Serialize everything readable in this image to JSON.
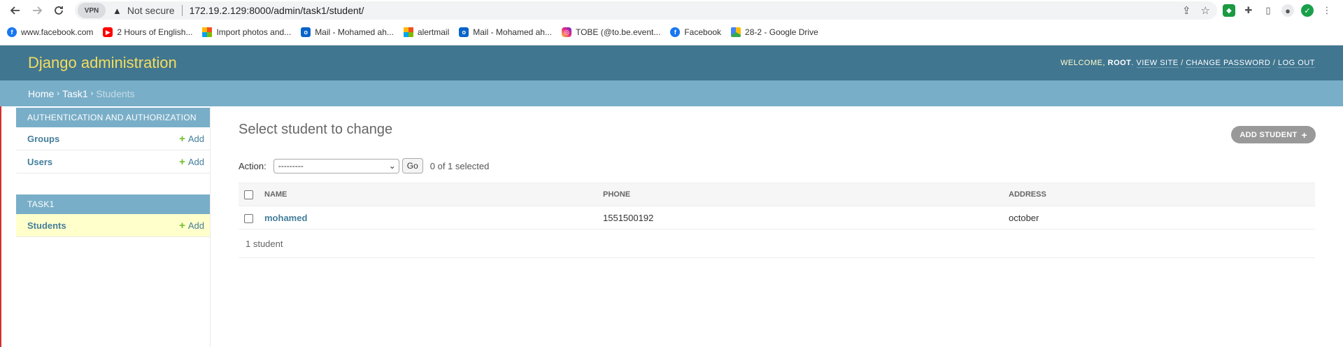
{
  "browser": {
    "vpn_label": "VPN",
    "security_label": "Not secure",
    "url": "172.19.2.129:8000/admin/task1/student/"
  },
  "bookmarks": [
    {
      "label": "www.facebook.com",
      "icon": "facebook-icon"
    },
    {
      "label": "2 Hours of English...",
      "icon": "youtube-icon"
    },
    {
      "label": "Import photos and...",
      "icon": "microsoft-icon"
    },
    {
      "label": "Mail - Mohamed ah...",
      "icon": "outlook-icon"
    },
    {
      "label": "alertmail",
      "icon": "microsoft-icon"
    },
    {
      "label": "Mail - Mohamed ah...",
      "icon": "outlook-icon"
    },
    {
      "label": "TOBE (@to.be.event...",
      "icon": "instagram-icon"
    },
    {
      "label": "Facebook",
      "icon": "facebook-icon"
    },
    {
      "label": "28-2 - Google Drive",
      "icon": "google-drive-icon"
    }
  ],
  "header": {
    "site_name": "Django administration",
    "welcome": "Welcome,",
    "username": "root",
    "view_site": "View site",
    "change_password": "Change password",
    "log_out": "Log out"
  },
  "breadcrumbs": {
    "home": "Home",
    "app": "Task1",
    "current": "Students"
  },
  "sidebar": {
    "modules": [
      {
        "caption": "Authentication and Authorization",
        "models": [
          {
            "label": "Groups",
            "add": "Add"
          },
          {
            "label": "Users",
            "add": "Add"
          }
        ]
      },
      {
        "caption": "Task1",
        "models": [
          {
            "label": "Students",
            "add": "Add"
          }
        ]
      }
    ]
  },
  "content": {
    "title": "Select student to change",
    "add_button": "Add student",
    "action_label": "Action:",
    "action_value": "---------",
    "go_label": "Go",
    "selected_count": "0 of 1 selected",
    "columns": [
      "Name",
      "Phone",
      "Address"
    ],
    "rows": [
      {
        "name": "mohamed",
        "phone": "1551500192",
        "address": "october"
      }
    ],
    "paginator": "1 student"
  },
  "colors": {
    "header_bg": "#417690",
    "branding": "#f5dd5d",
    "breadcrumbs_bg": "#79aec8",
    "link": "#447e9b",
    "add_green": "#70bf2b"
  }
}
